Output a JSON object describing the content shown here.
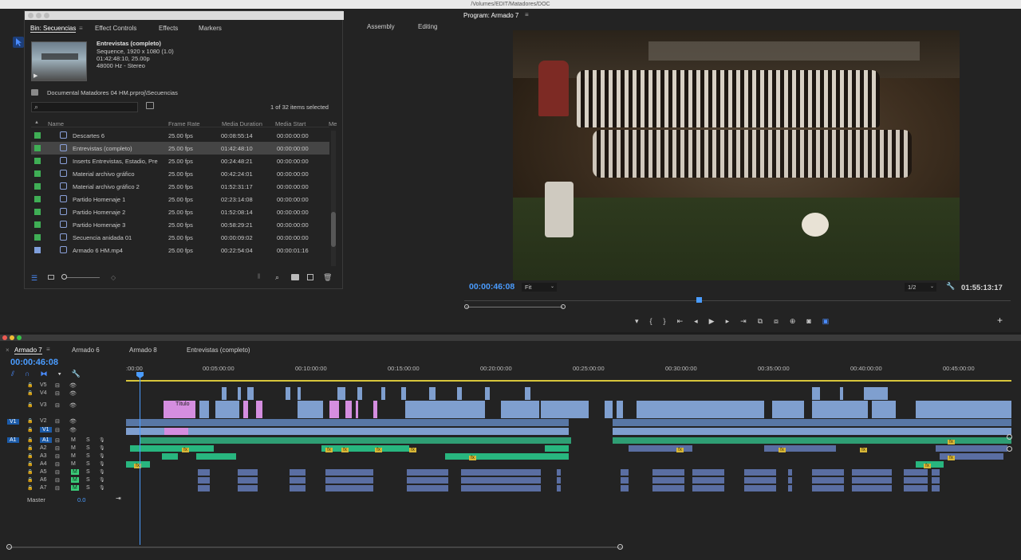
{
  "os_bar": {
    "path": "/Volumes/EDIT/Matadores/DOC"
  },
  "workspace": {
    "tabs": [
      "Assembly",
      "Editing"
    ]
  },
  "bin_panel": {
    "tabs": [
      "Bin: Secuencias",
      "Effect Controls",
      "Effects",
      "Markers"
    ],
    "preview": {
      "name": "Entrevistas (completo)",
      "line1": "Sequence, 1920 x 1080 (1.0)",
      "line2": "01:42:48:10, 25.00p",
      "line3": "48000 Hz - Stereo"
    },
    "path": "Documental Matadores 04 HM.prproj\\Secuencias",
    "selection_count": "1 of 32 items selected",
    "columns": [
      "Name",
      "Frame Rate",
      "Media Duration",
      "Media Start",
      "Me"
    ],
    "items": [
      {
        "name": "Descartes 6",
        "rate": "25.00 fps",
        "duration": "00:08:55:14",
        "start": "00:00:00:00",
        "label_color": "#3fae55",
        "icon": "sequence-icon"
      },
      {
        "name": "Entrevistas (completo)",
        "rate": "25.00 fps",
        "duration": "01:42:48:10",
        "start": "00:00:00:00",
        "label_color": "#3fae55",
        "icon": "sequence-icon",
        "selected": true
      },
      {
        "name": "Inserts Entrevistas, Estadio, Pre",
        "rate": "25.00 fps",
        "duration": "00:24:48:21",
        "start": "00:00:00:00",
        "label_color": "#3fae55",
        "icon": "sequence-icon"
      },
      {
        "name": "Material archivo gráfico",
        "rate": "25.00 fps",
        "duration": "00:42:24:01",
        "start": "00:00:00:00",
        "label_color": "#3fae55",
        "icon": "sequence-icon"
      },
      {
        "name": "Material archivo gráfico 2",
        "rate": "25.00 fps",
        "duration": "01:52:31:17",
        "start": "00:00:00:00",
        "label_color": "#3fae55",
        "icon": "sequence-icon"
      },
      {
        "name": "Partido Homenaje 1",
        "rate": "25.00 fps",
        "duration": "02:23:14:08",
        "start": "00:00:00:00",
        "label_color": "#3fae55",
        "icon": "sequence-icon"
      },
      {
        "name": "Partido Homenaje 2",
        "rate": "25.00 fps",
        "duration": "01:52:08:14",
        "start": "00:00:00:00",
        "label_color": "#3fae55",
        "icon": "sequence-icon"
      },
      {
        "name": "Partido Homenaje 3",
        "rate": "25.00 fps",
        "duration": "00:58:29:21",
        "start": "00:00:00:00",
        "label_color": "#3fae55",
        "icon": "sequence-icon"
      },
      {
        "name": "Secuencia anidada 01",
        "rate": "25.00 fps",
        "duration": "00:00:09:02",
        "start": "00:00:00:00",
        "label_color": "#3fae55",
        "icon": "sequence-icon"
      },
      {
        "name": "Armado 6 HM.mp4",
        "rate": "25.00 fps",
        "duration": "00:22:54:04",
        "start": "00:00:01:16",
        "label_color": "#7f9fdc",
        "icon": "video-file-icon"
      }
    ]
  },
  "program_monitor": {
    "title": "Program: Armado 7",
    "timecode": "00:00:46:08",
    "fit": "Fit",
    "resolution": "1/2",
    "duration": "01:55:13:17"
  },
  "timeline": {
    "tabs": [
      "Armado 7",
      "Armado 6",
      "Armado 8",
      "Entrevistas (completo)"
    ],
    "timecode": "00:00:46:08",
    "ruler": [
      ":00:00",
      "00:05:00:00",
      "00:10:00:00",
      "00:15:00:00",
      "00:20:00:00",
      "00:25:00:00",
      "00:30:00:00",
      "00:35:00:00",
      "00:40:00:00",
      "00:45:00:00"
    ],
    "video_tracks": [
      "V5",
      "V4",
      "V3",
      "V2",
      "V1"
    ],
    "audio_tracks": [
      "A1",
      "A2",
      "A3",
      "A4",
      "A5",
      "A6",
      "A7"
    ],
    "source_v": "V1",
    "source_a": "A1",
    "master": {
      "label": "Master",
      "value": "0.0"
    },
    "title_clip": "Título",
    "mute_label": "M",
    "solo_label": "S",
    "fx_label": "fx"
  }
}
